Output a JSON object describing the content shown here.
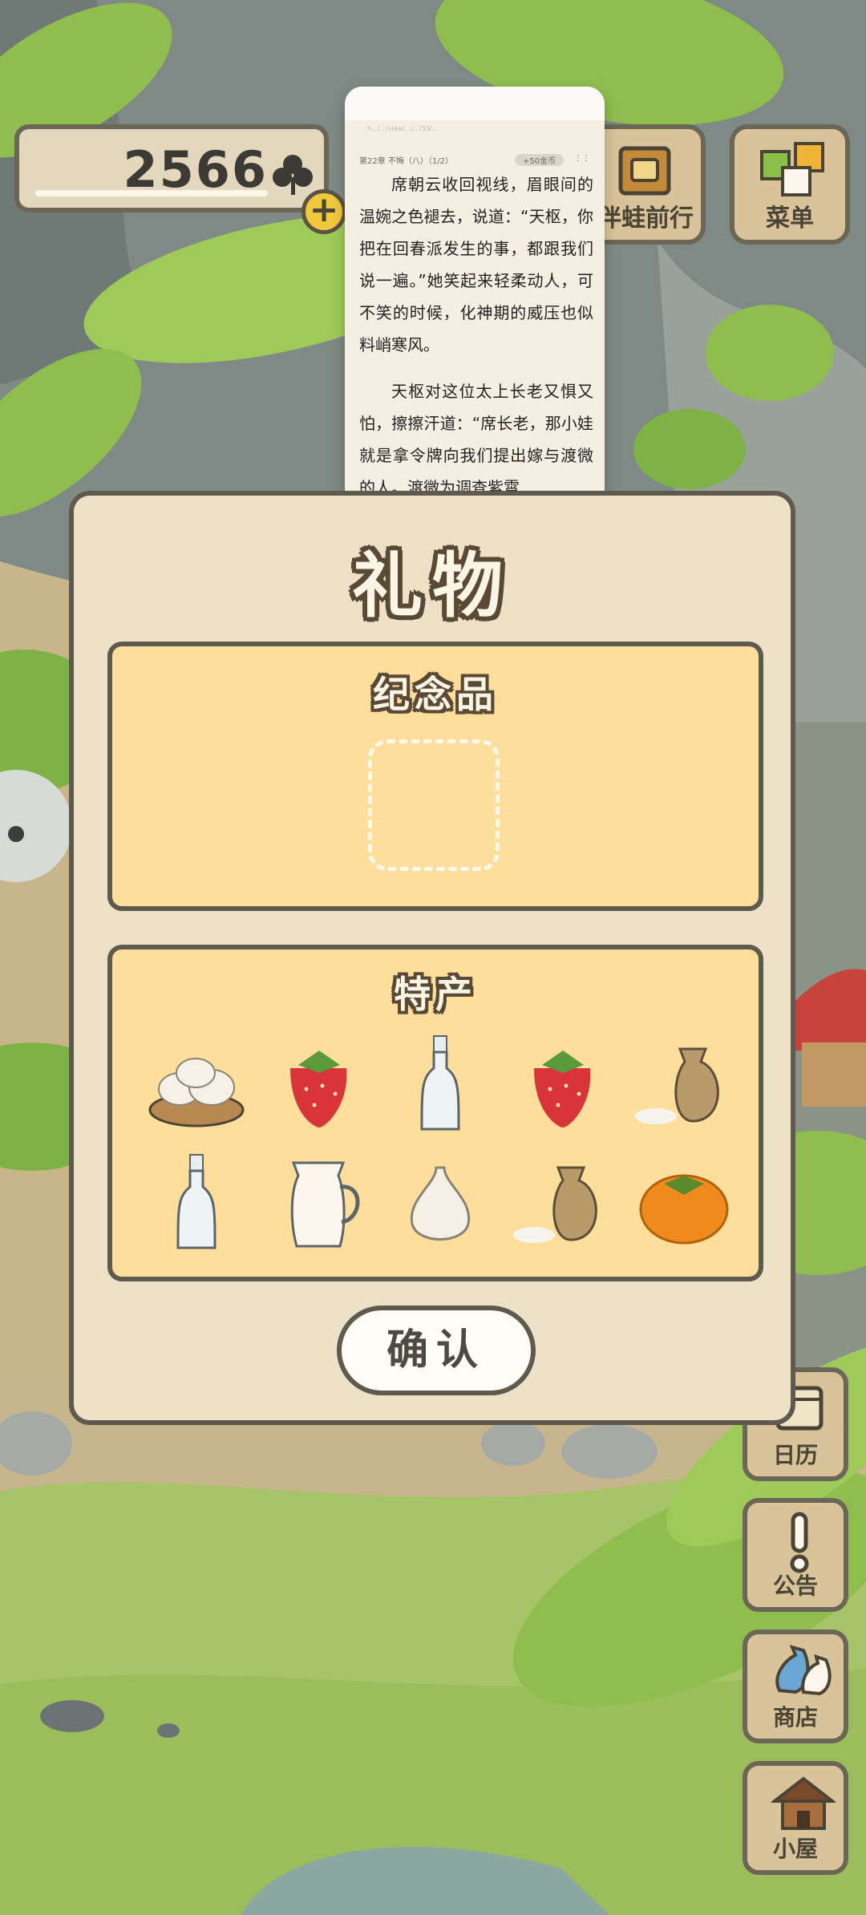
{
  "currency": {
    "clovers": "2566",
    "add_label": "+"
  },
  "top_buttons": [
    {
      "label": "伴蛙前行",
      "icon": "journal-icon"
    },
    {
      "label": "菜单",
      "icon": "menu-cards-icon"
    }
  ],
  "side_buttons": [
    {
      "label": "日历",
      "icon": "calendar-icon"
    },
    {
      "label": "公告",
      "icon": "exclamation-icon"
    },
    {
      "label": "商店",
      "icon": "bags-icon"
    },
    {
      "label": "小屋",
      "icon": "house-icon"
    }
  ],
  "reader": {
    "url_text": "h.../.../view/.../.../33/...",
    "chapter": "第22章 不悔（八）（1/2）",
    "coin_badge": "+50金币",
    "more": "⋮⋮",
    "paragraphs": [
      "席朝云收回视线，眉眼间的温婉之色褪去，说道：“天枢，你把在回春派发生的事，都跟我们说一遍。”她笑起来轻柔动人，可不笑的时候，化神期的威压也似料峭寒风。",
      "天枢对这位太上长老又惧又怕，擦擦汗道：“席长老，那小娃就是拿令牌向我们提出嫁与渡微的人。渡微为调查紫霄"
    ]
  },
  "gift_panel": {
    "title": "礼物",
    "souvenir": {
      "title": "纪念品"
    },
    "specialty": {
      "title": "特产",
      "items": [
        {
          "name": "dumplings-icon"
        },
        {
          "name": "strawberry-icon"
        },
        {
          "name": "bottle-icon"
        },
        {
          "name": "strawberry-icon"
        },
        {
          "name": "rice-sack-icon"
        },
        {
          "name": "bottle-icon"
        },
        {
          "name": "milk-pitcher-icon"
        },
        {
          "name": "garlic-icon"
        },
        {
          "name": "rice-sack-icon"
        },
        {
          "name": "persimmon-icon"
        }
      ]
    },
    "confirm_label": "确认"
  },
  "colors": {
    "panel_bg": "#ede2c8",
    "section_bg": "#fddf9b",
    "outline": "#5e5a4d",
    "leaf_green": "#8fbe4e"
  }
}
